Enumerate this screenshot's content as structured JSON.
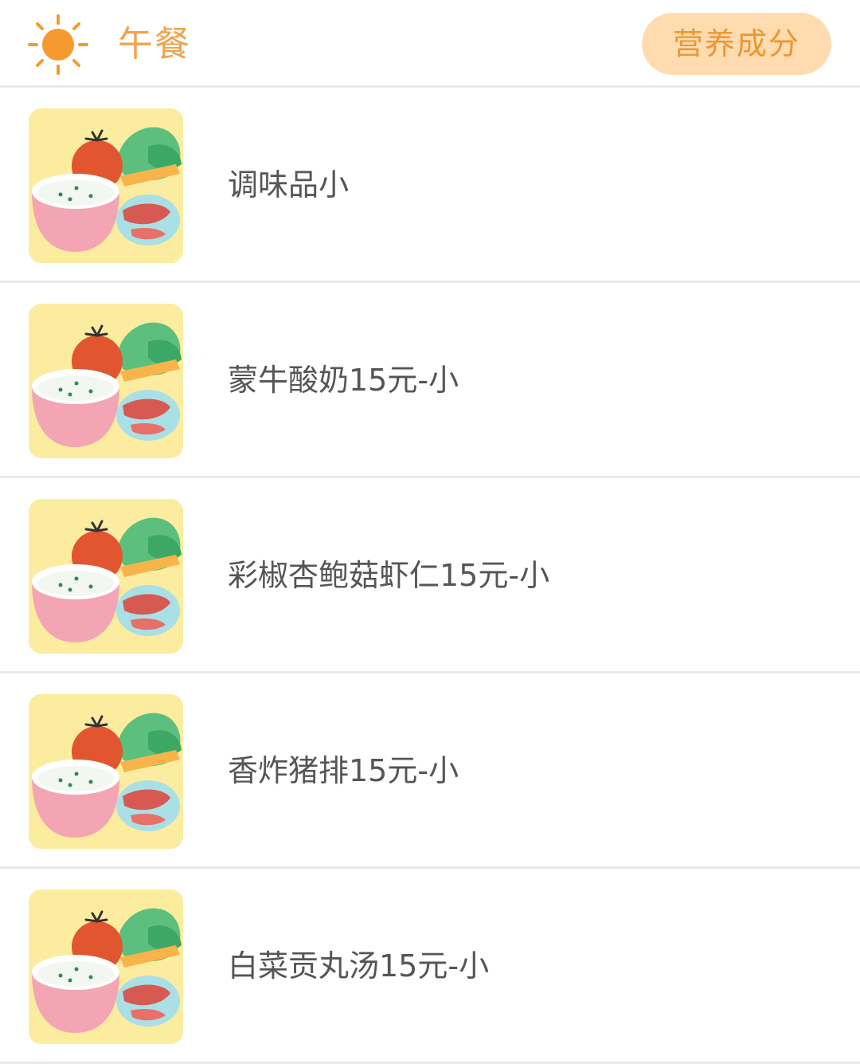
{
  "header": {
    "meal_title": "午餐",
    "nutrition_button_label": "营养成分",
    "icon": "sun-icon"
  },
  "colors": {
    "accent": "#f0a34a",
    "button_bg": "#ffdcb0",
    "thumb_bg": "#fcec9f",
    "text": "#555555",
    "divider": "#e9e9e9"
  },
  "items": [
    {
      "name": "调味品小",
      "icon": "food-plate-icon"
    },
    {
      "name": "蒙牛酸奶15元-小",
      "icon": "food-plate-icon"
    },
    {
      "name": "彩椒杏鲍菇虾仁15元-小",
      "icon": "food-plate-icon"
    },
    {
      "name": "香炸猪排15元-小",
      "icon": "food-plate-icon"
    },
    {
      "name": "白菜贡丸汤15元-小",
      "icon": "food-plate-icon"
    }
  ]
}
